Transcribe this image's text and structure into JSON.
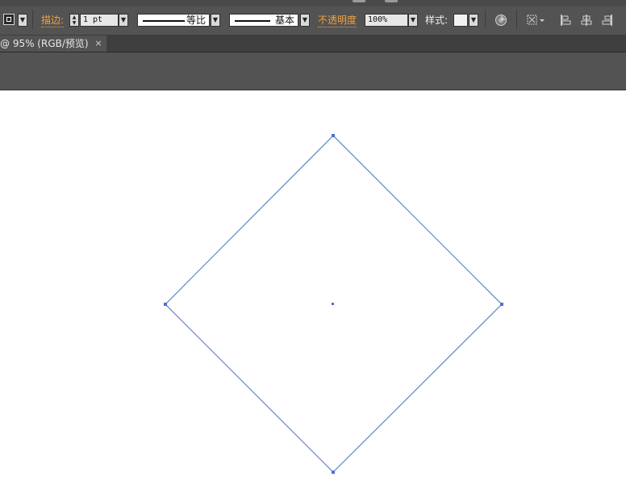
{
  "control_bar": {
    "stroke_label": "描边:",
    "stroke_weight": "1 pt",
    "variable_width_profile": "等比",
    "brush_definition": "基本",
    "opacity_label": "不透明度",
    "opacity_value": "100%",
    "style_label": "样式:"
  },
  "document_tab": {
    "title": "@ 95% (RGB/预览)",
    "close_glyph": "×"
  },
  "artwork": {
    "shape": "diamond",
    "stroke_color": "#6b8ccc",
    "selection_color": "#4a6fd8"
  }
}
